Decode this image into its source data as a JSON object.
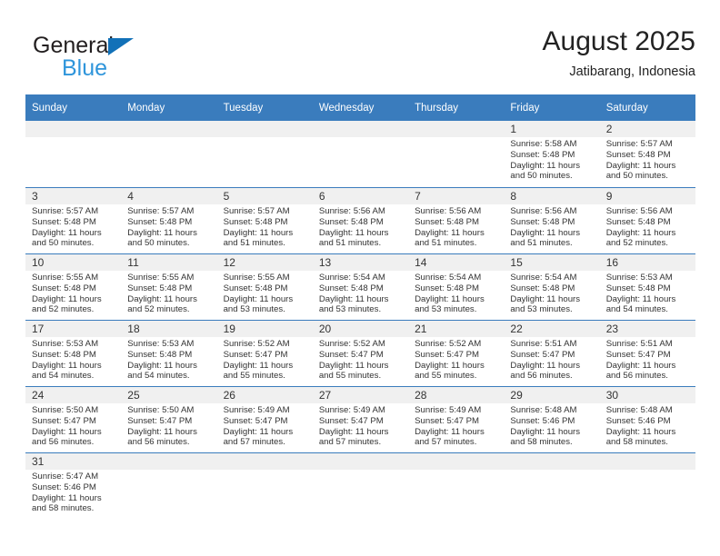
{
  "branding": {
    "name_part1": "General",
    "name_part2": "Blue",
    "triangle_color": "#1271b8",
    "blue_text_color": "#2f95db"
  },
  "header": {
    "title": "August 2025",
    "location": "Jatibarang, Indonesia"
  },
  "theme": {
    "header_blue": "#3a7cbd",
    "daynum_band": "#f0f0f0",
    "text": "#333333"
  },
  "weekday_headers": [
    "Sunday",
    "Monday",
    "Tuesday",
    "Wednesday",
    "Thursday",
    "Friday",
    "Saturday"
  ],
  "labels": {
    "sunrise_prefix": "Sunrise: ",
    "sunset_prefix": "Sunset: ",
    "daylight_prefix": "Daylight: "
  },
  "weeks": [
    [
      {
        "day": "",
        "sunrise": "",
        "sunset": "",
        "daylight": "",
        "empty": true
      },
      {
        "day": "",
        "sunrise": "",
        "sunset": "",
        "daylight": "",
        "empty": true
      },
      {
        "day": "",
        "sunrise": "",
        "sunset": "",
        "daylight": "",
        "empty": true
      },
      {
        "day": "",
        "sunrise": "",
        "sunset": "",
        "daylight": "",
        "empty": true
      },
      {
        "day": "",
        "sunrise": "",
        "sunset": "",
        "daylight": "",
        "empty": true
      },
      {
        "day": "1",
        "sunrise": "Sunrise: 5:58 AM",
        "sunset": "Sunset: 5:48 PM",
        "daylight": "Daylight: 11 hours and 50 minutes."
      },
      {
        "day": "2",
        "sunrise": "Sunrise: 5:57 AM",
        "sunset": "Sunset: 5:48 PM",
        "daylight": "Daylight: 11 hours and 50 minutes."
      }
    ],
    [
      {
        "day": "3",
        "sunrise": "Sunrise: 5:57 AM",
        "sunset": "Sunset: 5:48 PM",
        "daylight": "Daylight: 11 hours and 50 minutes."
      },
      {
        "day": "4",
        "sunrise": "Sunrise: 5:57 AM",
        "sunset": "Sunset: 5:48 PM",
        "daylight": "Daylight: 11 hours and 50 minutes."
      },
      {
        "day": "5",
        "sunrise": "Sunrise: 5:57 AM",
        "sunset": "Sunset: 5:48 PM",
        "daylight": "Daylight: 11 hours and 51 minutes."
      },
      {
        "day": "6",
        "sunrise": "Sunrise: 5:56 AM",
        "sunset": "Sunset: 5:48 PM",
        "daylight": "Daylight: 11 hours and 51 minutes."
      },
      {
        "day": "7",
        "sunrise": "Sunrise: 5:56 AM",
        "sunset": "Sunset: 5:48 PM",
        "daylight": "Daylight: 11 hours and 51 minutes."
      },
      {
        "day": "8",
        "sunrise": "Sunrise: 5:56 AM",
        "sunset": "Sunset: 5:48 PM",
        "daylight": "Daylight: 11 hours and 51 minutes."
      },
      {
        "day": "9",
        "sunrise": "Sunrise: 5:56 AM",
        "sunset": "Sunset: 5:48 PM",
        "daylight": "Daylight: 11 hours and 52 minutes."
      }
    ],
    [
      {
        "day": "10",
        "sunrise": "Sunrise: 5:55 AM",
        "sunset": "Sunset: 5:48 PM",
        "daylight": "Daylight: 11 hours and 52 minutes."
      },
      {
        "day": "11",
        "sunrise": "Sunrise: 5:55 AM",
        "sunset": "Sunset: 5:48 PM",
        "daylight": "Daylight: 11 hours and 52 minutes."
      },
      {
        "day": "12",
        "sunrise": "Sunrise: 5:55 AM",
        "sunset": "Sunset: 5:48 PM",
        "daylight": "Daylight: 11 hours and 53 minutes."
      },
      {
        "day": "13",
        "sunrise": "Sunrise: 5:54 AM",
        "sunset": "Sunset: 5:48 PM",
        "daylight": "Daylight: 11 hours and 53 minutes."
      },
      {
        "day": "14",
        "sunrise": "Sunrise: 5:54 AM",
        "sunset": "Sunset: 5:48 PM",
        "daylight": "Daylight: 11 hours and 53 minutes."
      },
      {
        "day": "15",
        "sunrise": "Sunrise: 5:54 AM",
        "sunset": "Sunset: 5:48 PM",
        "daylight": "Daylight: 11 hours and 53 minutes."
      },
      {
        "day": "16",
        "sunrise": "Sunrise: 5:53 AM",
        "sunset": "Sunset: 5:48 PM",
        "daylight": "Daylight: 11 hours and 54 minutes."
      }
    ],
    [
      {
        "day": "17",
        "sunrise": "Sunrise: 5:53 AM",
        "sunset": "Sunset: 5:48 PM",
        "daylight": "Daylight: 11 hours and 54 minutes."
      },
      {
        "day": "18",
        "sunrise": "Sunrise: 5:53 AM",
        "sunset": "Sunset: 5:48 PM",
        "daylight": "Daylight: 11 hours and 54 minutes."
      },
      {
        "day": "19",
        "sunrise": "Sunrise: 5:52 AM",
        "sunset": "Sunset: 5:47 PM",
        "daylight": "Daylight: 11 hours and 55 minutes."
      },
      {
        "day": "20",
        "sunrise": "Sunrise: 5:52 AM",
        "sunset": "Sunset: 5:47 PM",
        "daylight": "Daylight: 11 hours and 55 minutes."
      },
      {
        "day": "21",
        "sunrise": "Sunrise: 5:52 AM",
        "sunset": "Sunset: 5:47 PM",
        "daylight": "Daylight: 11 hours and 55 minutes."
      },
      {
        "day": "22",
        "sunrise": "Sunrise: 5:51 AM",
        "sunset": "Sunset: 5:47 PM",
        "daylight": "Daylight: 11 hours and 56 minutes."
      },
      {
        "day": "23",
        "sunrise": "Sunrise: 5:51 AM",
        "sunset": "Sunset: 5:47 PM",
        "daylight": "Daylight: 11 hours and 56 minutes."
      }
    ],
    [
      {
        "day": "24",
        "sunrise": "Sunrise: 5:50 AM",
        "sunset": "Sunset: 5:47 PM",
        "daylight": "Daylight: 11 hours and 56 minutes."
      },
      {
        "day": "25",
        "sunrise": "Sunrise: 5:50 AM",
        "sunset": "Sunset: 5:47 PM",
        "daylight": "Daylight: 11 hours and 56 minutes."
      },
      {
        "day": "26",
        "sunrise": "Sunrise: 5:49 AM",
        "sunset": "Sunset: 5:47 PM",
        "daylight": "Daylight: 11 hours and 57 minutes."
      },
      {
        "day": "27",
        "sunrise": "Sunrise: 5:49 AM",
        "sunset": "Sunset: 5:47 PM",
        "daylight": "Daylight: 11 hours and 57 minutes."
      },
      {
        "day": "28",
        "sunrise": "Sunrise: 5:49 AM",
        "sunset": "Sunset: 5:47 PM",
        "daylight": "Daylight: 11 hours and 57 minutes."
      },
      {
        "day": "29",
        "sunrise": "Sunrise: 5:48 AM",
        "sunset": "Sunset: 5:46 PM",
        "daylight": "Daylight: 11 hours and 58 minutes."
      },
      {
        "day": "30",
        "sunrise": "Sunrise: 5:48 AM",
        "sunset": "Sunset: 5:46 PM",
        "daylight": "Daylight: 11 hours and 58 minutes."
      }
    ],
    [
      {
        "day": "31",
        "sunrise": "Sunrise: 5:47 AM",
        "sunset": "Sunset: 5:46 PM",
        "daylight": "Daylight: 11 hours and 58 minutes."
      },
      {
        "day": "",
        "sunrise": "",
        "sunset": "",
        "daylight": "",
        "empty": true
      },
      {
        "day": "",
        "sunrise": "",
        "sunset": "",
        "daylight": "",
        "empty": true
      },
      {
        "day": "",
        "sunrise": "",
        "sunset": "",
        "daylight": "",
        "empty": true
      },
      {
        "day": "",
        "sunrise": "",
        "sunset": "",
        "daylight": "",
        "empty": true
      },
      {
        "day": "",
        "sunrise": "",
        "sunset": "",
        "daylight": "",
        "empty": true
      },
      {
        "day": "",
        "sunrise": "",
        "sunset": "",
        "daylight": "",
        "empty": true
      }
    ]
  ]
}
